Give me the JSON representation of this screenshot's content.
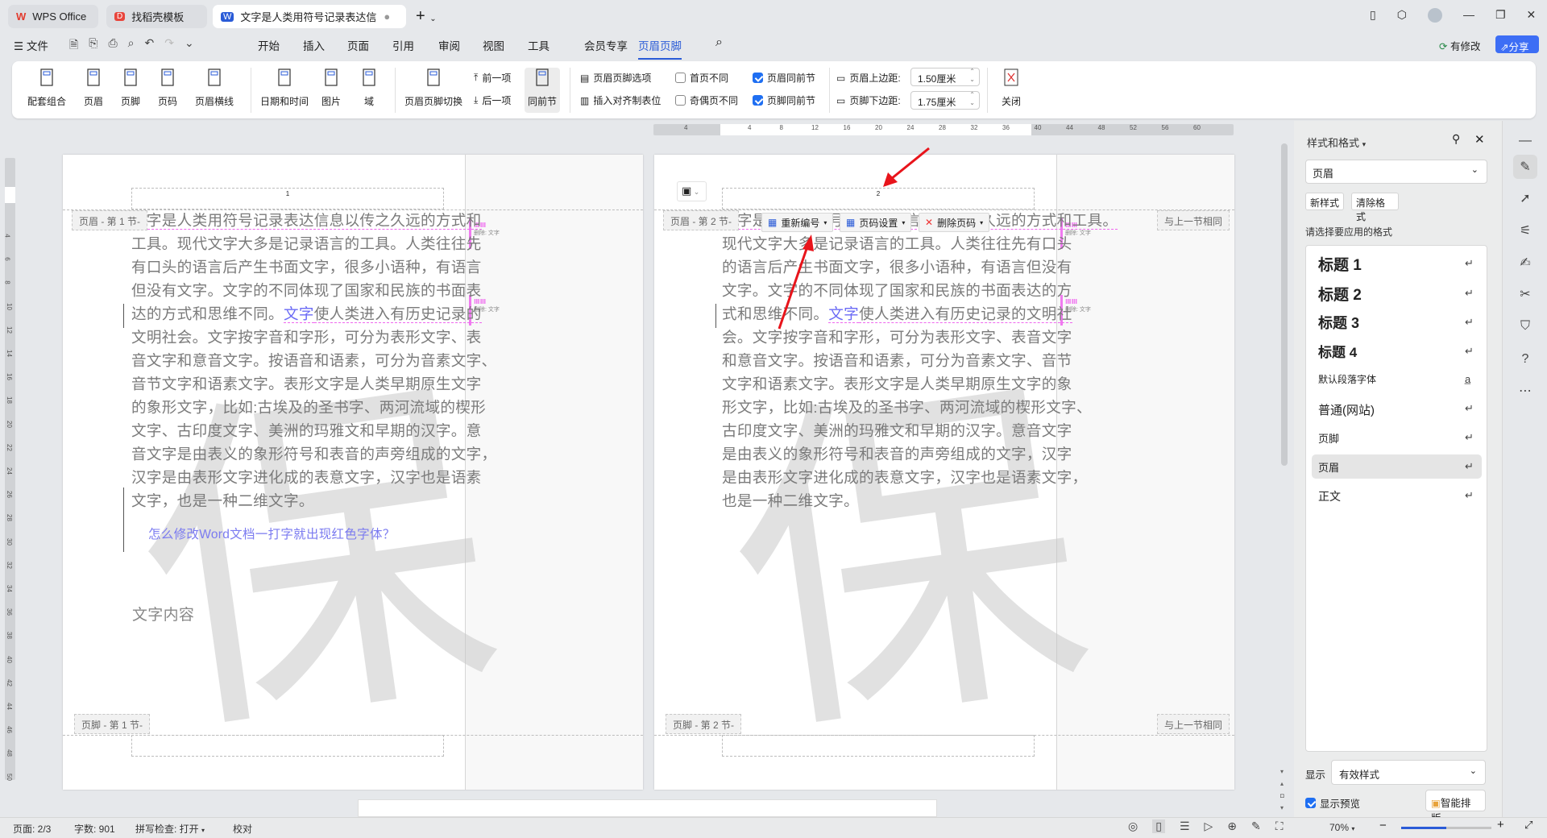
{
  "tabs": [
    {
      "label": "WPS Office"
    },
    {
      "label": "找稻壳模板"
    },
    {
      "label": "文字是人类用符号记录表达信息以传"
    }
  ],
  "menu": {
    "file": "文件",
    "items": [
      "开始",
      "插入",
      "页面",
      "引用",
      "审阅",
      "视图",
      "工具",
      "会员专享",
      "页眉页脚"
    ],
    "modified": "有修改",
    "share": "分享"
  },
  "ribbon": {
    "big": [
      "配套组合",
      "页眉",
      "页脚",
      "页码",
      "页眉横线",
      "日期和时间",
      "图片",
      "域",
      "页眉页脚切换",
      "同前节",
      "关闭"
    ],
    "prev": "前一项",
    "next": "后一项",
    "options": "页眉页脚选项",
    "align_tab": "插入对齐制表位",
    "first_diff": "首页不同",
    "odd_even_diff": "奇偶页不同",
    "header_link": "页眉同前节",
    "footer_link": "页脚同前节",
    "header_top_label": "页眉上边距:",
    "header_top_value": "1.50厘米",
    "footer_bottom_label": "页脚下边距:",
    "footer_bottom_value": "1.75厘米",
    "checks": {
      "first_diff": false,
      "odd_even_diff": false,
      "header_link": true,
      "footer_link": true
    }
  },
  "ruler": {
    "h": [
      "4",
      "",
      "4",
      "8",
      "12",
      "16",
      "20",
      "24",
      "28",
      "32",
      "36",
      "40",
      "44",
      "48",
      "52",
      "56",
      "60"
    ],
    "v": [
      "4",
      "6",
      "8",
      "10",
      "12",
      "14",
      "16",
      "18",
      "20",
      "22",
      "24",
      "26",
      "28",
      "30",
      "32",
      "34",
      "36",
      "38",
      "40",
      "42",
      "44",
      "46",
      "48",
      "50"
    ]
  },
  "watermark": {
    "text": "保"
  },
  "page1": {
    "header_label": "页眉 - 第 1 节-",
    "footer_label": "页脚 - 第 1 节-",
    "page_number": "1",
    "lines": [
      {
        "pre": "",
        "mark": "",
        "post": "文字是人类用符号记录表达信息以传之久远的方式和",
        "u": true
      },
      {
        "pre": "工具。现代文字大多是记录语言的工具。人类往往先"
      },
      {
        "pre": "有口头的语言后产生书面文字，很多小语种，有语言"
      },
      {
        "pre": "但没有文字。文字的不同体现了国家和民族的书面表"
      },
      {
        "pre": "达的方式和思维不同。",
        "mark": "文字",
        "post": "使人类进入有历史记录的",
        "u": true
      },
      {
        "pre": "文明社会。文字按字音和字形，可分为表形文字、表"
      },
      {
        "pre": "音文字和意音文字。按语音和语素，可分为音素文字、"
      },
      {
        "pre": "音节文字和语素文字。表形文字是人类早期原生文字"
      },
      {
        "pre": "的象形文字，比如:古埃及的圣书字、两河流域的楔形"
      },
      {
        "pre": "文字、古印度文字、美洲的玛雅文和早期的汉字。意"
      },
      {
        "pre": "音文字是由表义的象形符号和表音的声旁组成的文字，"
      },
      {
        "pre": "汉字是由表形文字进化成的表意文字，汉字也是语素"
      },
      {
        "pre": "文字，也是一种二维文字。"
      }
    ],
    "link": "怎么修改Word文档一打字就出现红色字体？",
    "content": "文字内容",
    "balloons": [
      {
        "title": "ⅢⅢ",
        "text": "删除: 文字"
      },
      {
        "title": "ⅢⅢ",
        "text": "删除: 文字"
      }
    ]
  },
  "page2": {
    "header_label": "页眉 - 第 2 节-",
    "footer_label": "页脚 - 第 2 节-",
    "page_number": "2",
    "same_as_prev": "与上一节相同",
    "footer_same_as_prev": "与上一节相同",
    "toolbar": {
      "renumber": "重新编号",
      "page_setup": "页码设置",
      "delete": "删除页码"
    },
    "lines": [
      {
        "pre": "",
        "mark": "",
        "post": "文字是人类用符号记录表达信息以传之久远的方式和工具。",
        "u": true
      },
      {
        "pre": "现代文字大多是记录语言的工具。人类往往先有口头"
      },
      {
        "pre": "的语言后产生书面文字，很多小语种，有语言但没有"
      },
      {
        "pre": "文字。文字的不同体现了国家和民族的书面表达的方"
      },
      {
        "pre": "式和思维不同。",
        "mark": "文字",
        "post": "使人类进入有历史记录的文明社",
        "u": true
      },
      {
        "pre": "会。文字按字音和字形，可分为表形文字、表音文字"
      },
      {
        "pre": "和意音文字。按语音和语素，可分为音素文字、音节"
      },
      {
        "pre": "文字和语素文字。表形文字是人类早期原生文字的象"
      },
      {
        "pre": "形文字，比如:古埃及的圣书字、两河流域的楔形文字、"
      },
      {
        "pre": "古印度文字、美洲的玛雅文和早期的汉字。意音文字"
      },
      {
        "pre": "是由表义的象形符号和表音的声旁组成的文字，汉字"
      },
      {
        "pre": "是由表形文字进化成的表意文字，汉字也是语素文字，"
      },
      {
        "pre": "也是一种二维文字。"
      }
    ],
    "balloons": [
      {
        "title": "ⅢⅢ",
        "text": "删除: 文字"
      },
      {
        "title": "ⅢⅢ",
        "text": "删除: 文字"
      }
    ]
  },
  "panel": {
    "title": "样式和格式",
    "current": "页眉",
    "new_style": "新样式",
    "clear": "清除格式",
    "prompt": "请选择要应用的格式",
    "styles": [
      {
        "name": "标题 1",
        "size": 19,
        "bold": true
      },
      {
        "name": "标题 2",
        "size": 19,
        "bold": true
      },
      {
        "name": "标题 3",
        "size": 18,
        "bold": true
      },
      {
        "name": "标题 4",
        "size": 17,
        "bold": true
      },
      {
        "name": "默认段落字体",
        "size": 12,
        "bold": false,
        "sym": "a"
      },
      {
        "name": "普通(网站)",
        "size": 15,
        "bold": false
      },
      {
        "name": "页脚",
        "size": 13,
        "bold": false
      },
      {
        "name": "页眉",
        "size": 13,
        "bold": false,
        "selected": true
      },
      {
        "name": "正文",
        "size": 14,
        "bold": false
      }
    ],
    "show_label": "显示",
    "show_value": "有效样式",
    "preview": "显示预览",
    "preview_checked": true,
    "smart": "智能排版"
  },
  "status": {
    "page": "页面: 2/3",
    "words": "字数: 901",
    "spell": "拼写检查: 打开",
    "proof": "校对",
    "zoom": "70%",
    "zoom_level": 70
  },
  "colors": {
    "accent": "#2a5bd7",
    "track_insert": "#6b6bf5",
    "track_balloon": "#f07af0",
    "annotation_arrow": "#e8141b"
  }
}
